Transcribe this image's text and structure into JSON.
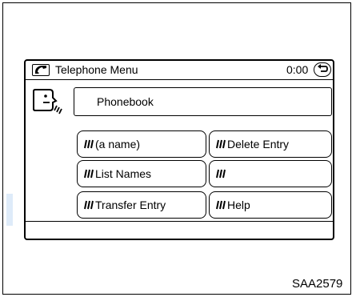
{
  "window": {
    "title": "Telephone Menu",
    "timer": "0:00"
  },
  "phonebook": {
    "label": "Phonebook"
  },
  "menu": {
    "items": [
      {
        "label": "(a name)"
      },
      {
        "label": "Delete Entry"
      },
      {
        "label": "List Names"
      },
      {
        "label": ""
      },
      {
        "label": "Transfer Entry"
      },
      {
        "label": "Help"
      }
    ]
  },
  "icons": {
    "title": "phone-handset-icon",
    "back": "back-arrow-icon",
    "voice": "voice-recognition-icon",
    "menu_item": "voice-command-icon"
  },
  "figure_code": "SAA2579",
  "colors": {
    "line": "#000000",
    "background": "#ffffff",
    "watermark": "#6fa7e6"
  }
}
